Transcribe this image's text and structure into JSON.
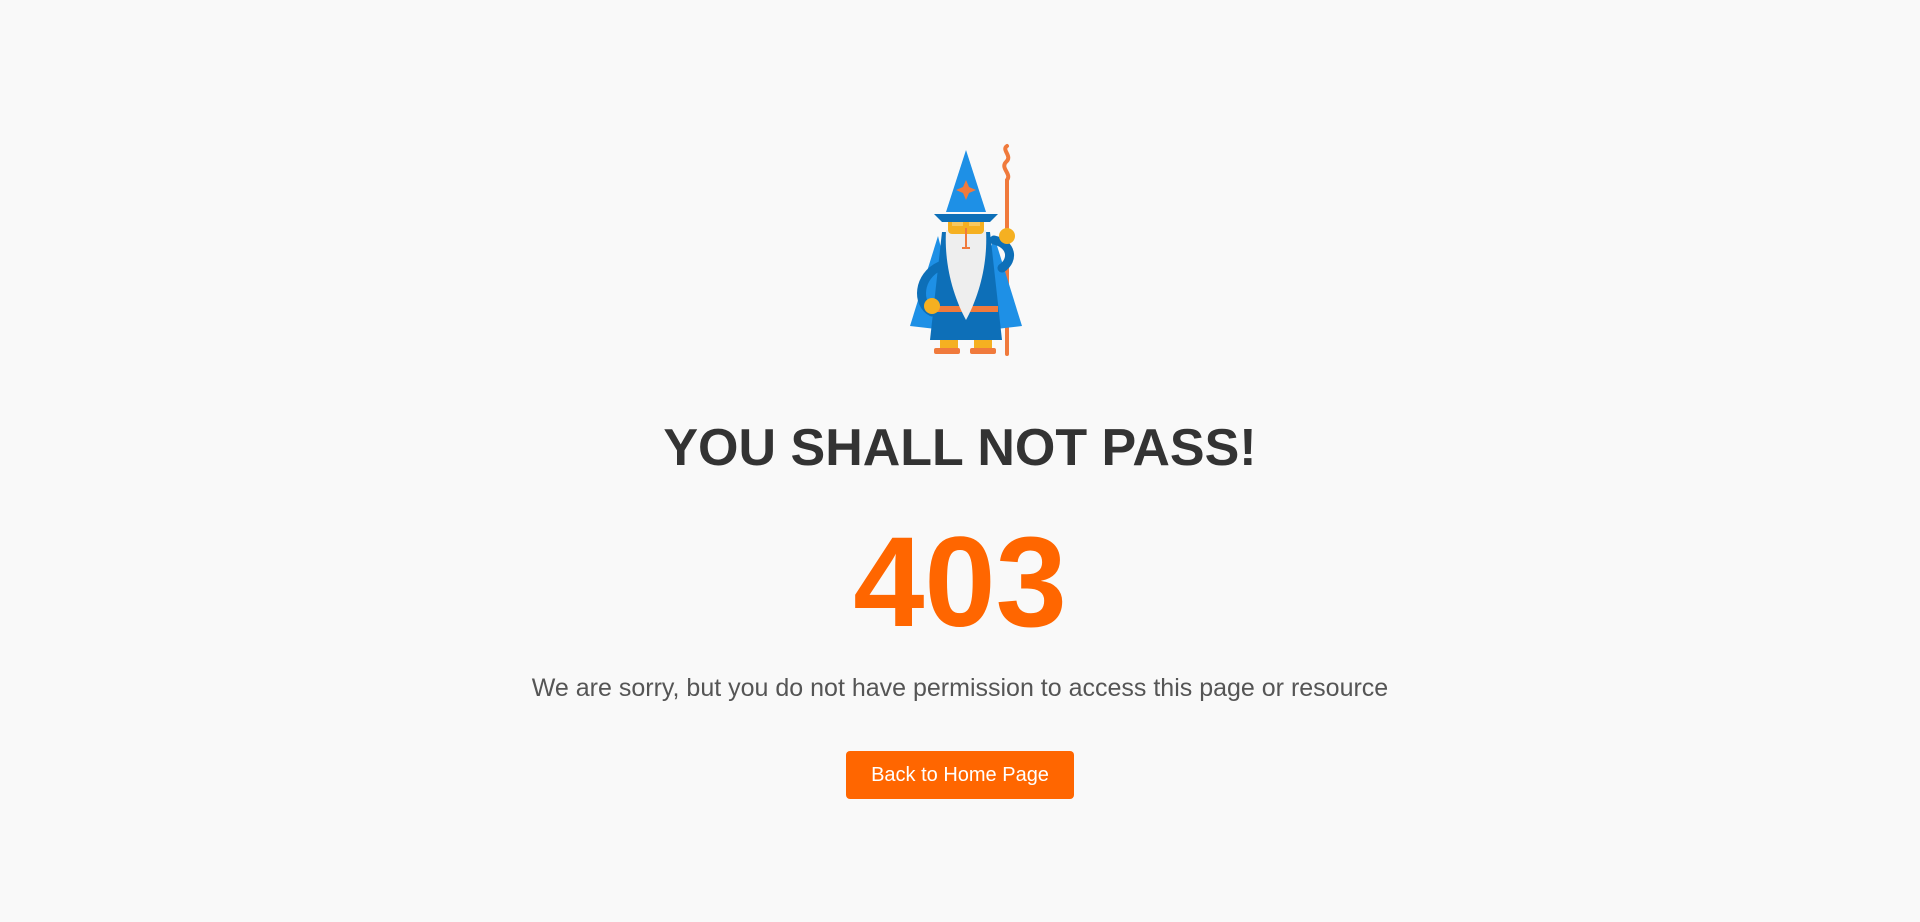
{
  "illustration": {
    "icon": "wizard-icon",
    "colors": {
      "hat": "#1e90e6",
      "robe": "#1e90e6",
      "robe_dark": "#0d6fb8",
      "beard": "#eeeeee",
      "skin": "#f5b021",
      "staff": "#f07a3c"
    }
  },
  "error": {
    "title": "YOU SHALL NOT PASS!",
    "code": "403",
    "message": "We are sorry, but you do not have permission to access this page or resource"
  },
  "actions": {
    "home_label": "Back to Home Page"
  },
  "colors": {
    "background": "#f9f9f9",
    "accent": "#ff6600",
    "title": "#333333",
    "message": "#555555"
  }
}
